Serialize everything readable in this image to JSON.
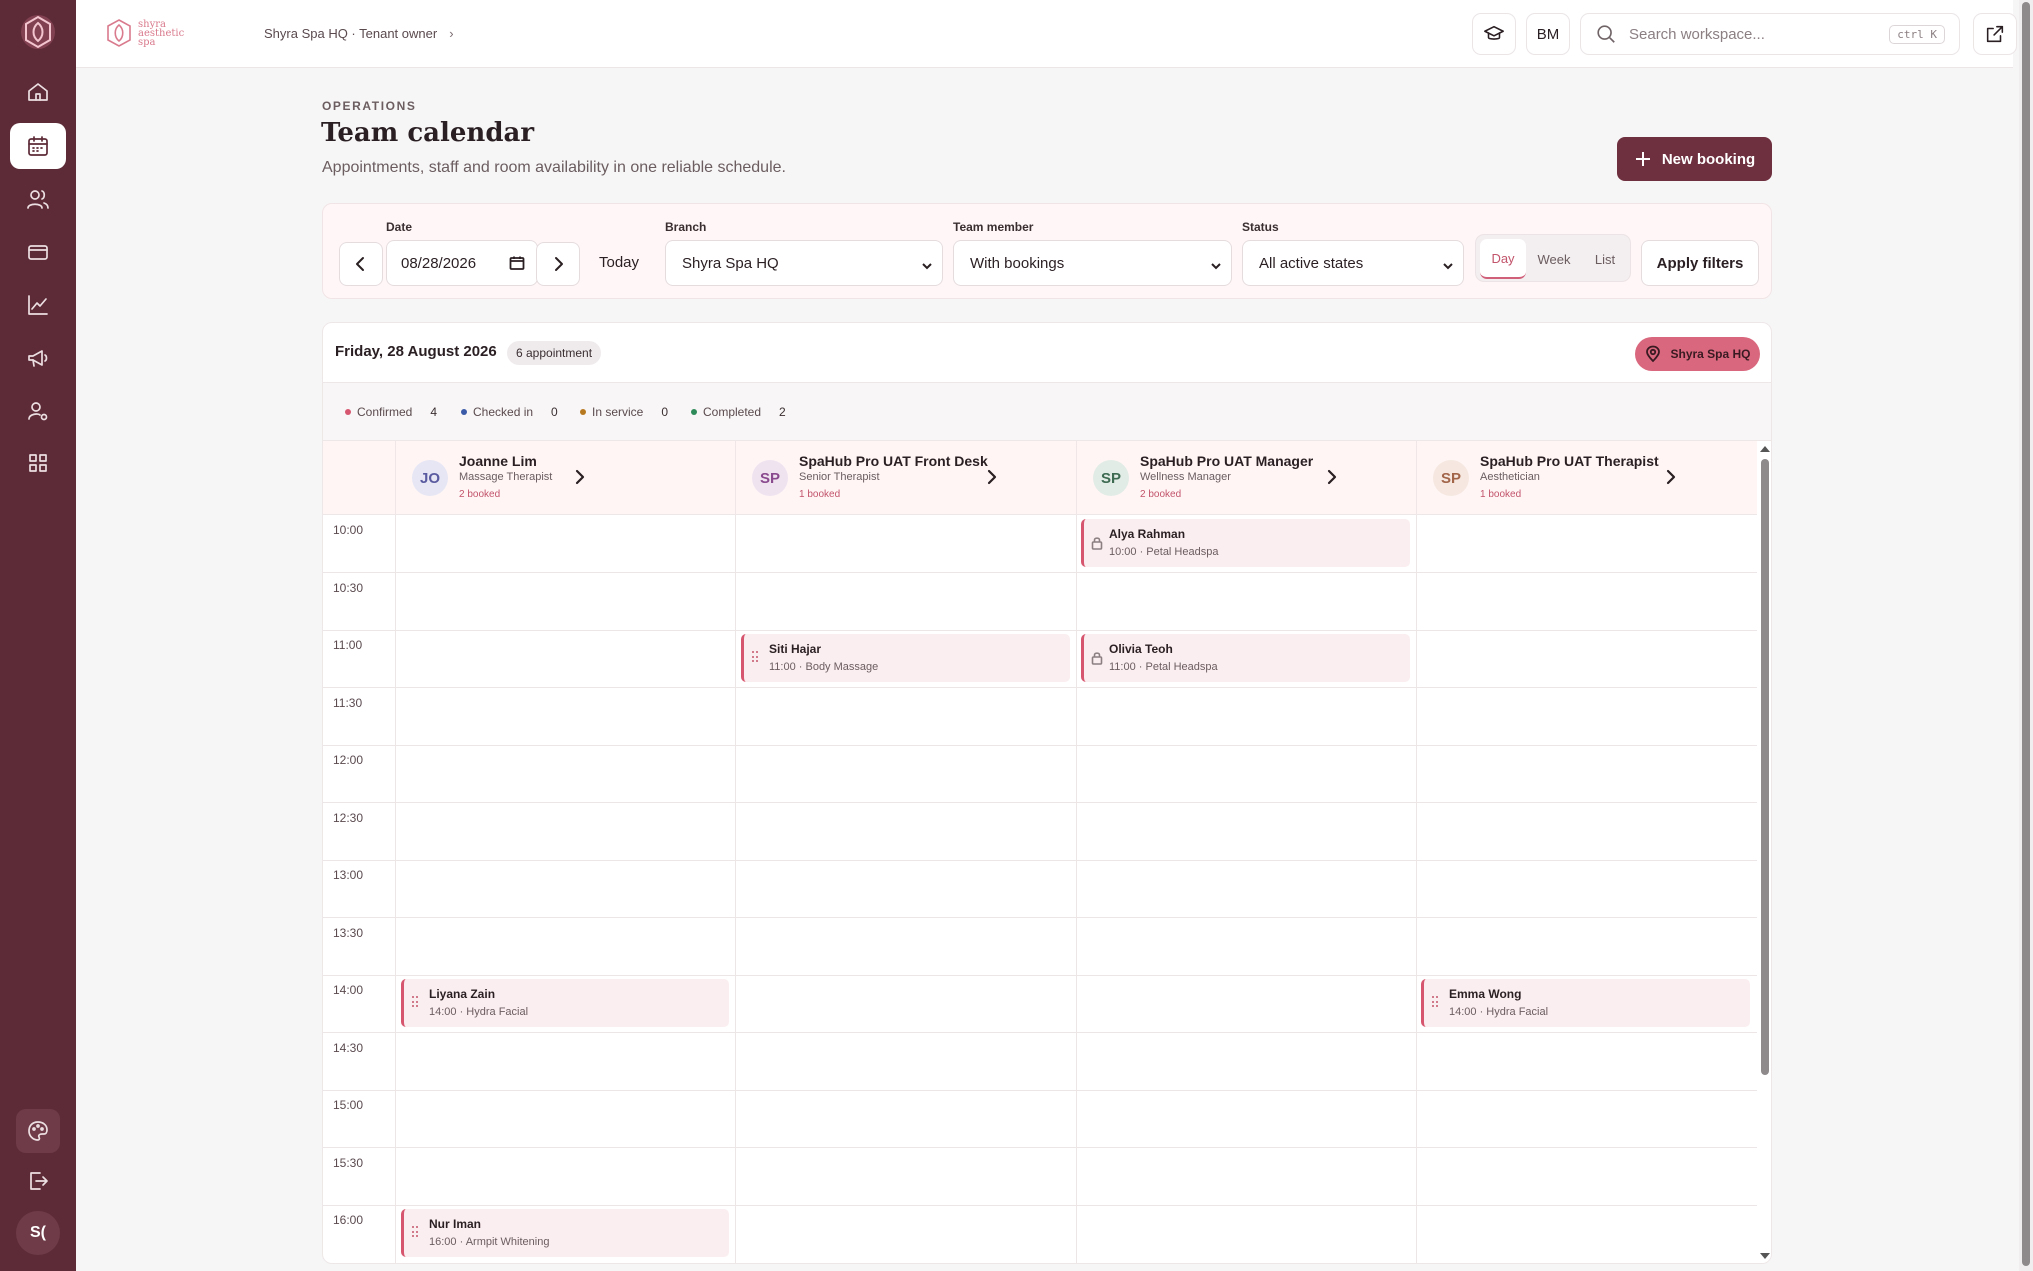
{
  "brand": {
    "line1": "shyra",
    "line2": "aesthetic",
    "line3": "spa"
  },
  "breadcrumb": {
    "text": "Shyra Spa HQ · Tenant owner"
  },
  "topbar": {
    "initials": "BM",
    "search_placeholder": "Search workspace...",
    "shortcut": "ctrl K"
  },
  "header": {
    "eyebrow": "OPERATIONS",
    "title": "Team calendar",
    "subtitle": "Appointments, staff and room availability in one reliable schedule.",
    "new_booking_label": "New booking"
  },
  "filters": {
    "date_label": "Date",
    "date_value": "08/28/2026",
    "today_label": "Today",
    "branch_label": "Branch",
    "branch_value": "Shyra Spa HQ",
    "team_label": "Team member",
    "team_value": "With bookings",
    "status_label": "Status",
    "status_value": "All active states",
    "views": [
      "Day",
      "Week",
      "List"
    ],
    "active_view": "Day",
    "apply_label": "Apply filters"
  },
  "calendar": {
    "date_title": "Friday, 28 August 2026",
    "appointment_count": "6 appointment",
    "branch_pill": "Shyra Spa HQ",
    "legend": [
      {
        "label": "Confirmed",
        "count": "4",
        "color": "#d6566f"
      },
      {
        "label": "Checked in",
        "count": "0",
        "color": "#3b5ba8"
      },
      {
        "label": "In service",
        "count": "0",
        "color": "#b7791f"
      },
      {
        "label": "Completed",
        "count": "2",
        "color": "#2f8a5a"
      }
    ],
    "staff": [
      {
        "initials": "JO",
        "name": "Joanne Lim",
        "role": "Massage Therapist",
        "booked": "2 booked",
        "avatar_bg": "#e6e6f4",
        "avatar_fg": "#5a5aa0"
      },
      {
        "initials": "SP",
        "name": "SpaHub Pro UAT Front Desk",
        "role": "Senior Therapist",
        "booked": "1 booked",
        "avatar_bg": "#efe3f0",
        "avatar_fg": "#8a4a8e"
      },
      {
        "initials": "SP",
        "name": "SpaHub Pro UAT Manager",
        "role": "Wellness Manager",
        "booked": "2 booked",
        "avatar_bg": "#e2ece6",
        "avatar_fg": "#3d6b52"
      },
      {
        "initials": "SP",
        "name": "SpaHub Pro UAT Therapist",
        "role": "Aesthetician",
        "booked": "1 booked",
        "avatar_bg": "#f6e8e0",
        "avatar_fg": "#a2654a"
      }
    ],
    "times": [
      "10:00",
      "10:30",
      "11:00",
      "11:30",
      "12:00",
      "12:30",
      "13:00",
      "13:30",
      "14:00",
      "14:30",
      "15:00",
      "15:30",
      "16:00"
    ],
    "appointments": [
      {
        "name": "Alya Rahman",
        "meta": "10:00 · Petal Headspa",
        "icon": "lock-icon"
      },
      {
        "name": "Siti Hajar",
        "meta": "11:00 · Body Massage",
        "icon": "grip-icon"
      },
      {
        "name": "Olivia Teoh",
        "meta": "11:00 · Petal Headspa",
        "icon": "lock-icon"
      },
      {
        "name": "Liyana Zain",
        "meta": "14:00 · Hydra Facial",
        "icon": "grip-icon"
      },
      {
        "name": "Emma Wong",
        "meta": "14:00 · Hydra Facial",
        "icon": "grip-icon"
      },
      {
        "name": "Nur Iman",
        "meta": "16:00 · Armpit Whitening",
        "icon": "grip-icon"
      }
    ]
  },
  "sidebar": {
    "avatar_initials": "S("
  }
}
